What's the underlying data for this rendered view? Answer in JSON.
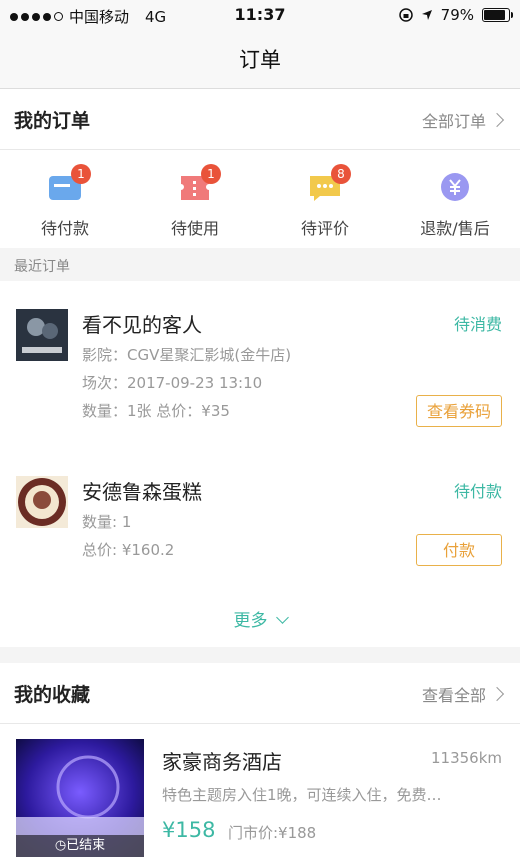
{
  "status_bar": {
    "carrier": "中国移动",
    "network": "4G",
    "time": "11:37",
    "battery": "79%"
  },
  "nav": {
    "title": "订单"
  },
  "my_orders": {
    "title": "我的订单",
    "all_link": "全部订单",
    "quick": [
      {
        "label": "待付款",
        "badge": "1",
        "icon": "card-icon",
        "color": "#5b9ee9"
      },
      {
        "label": "待使用",
        "badge": "1",
        "icon": "ticket-icon",
        "color": "#ef6f6f"
      },
      {
        "label": "待评价",
        "badge": "8",
        "icon": "comment-icon",
        "color": "#f1c232"
      },
      {
        "label": "退款/售后",
        "badge": "",
        "icon": "yen-icon",
        "color": "#8f8ef0"
      }
    ]
  },
  "recent": {
    "label": "最近订单",
    "orders": [
      {
        "name": "看不见的客人",
        "status": "待消费",
        "cinema": "影院：CGV星聚汇影城(金牛店)",
        "session": "场次：2017-09-23 13:10",
        "qty_price": "数量：1张 总价：¥35",
        "button": "查看券码"
      },
      {
        "name": "安德鲁森蛋糕",
        "status": "待付款",
        "qty": "数量: 1",
        "total": "总价: ¥160.2",
        "button": "付款"
      }
    ],
    "more": "更多"
  },
  "favorites": {
    "title": "我的收藏",
    "all_link": "查看全部",
    "item": {
      "name": "家豪商务酒店",
      "distance": "11356km",
      "desc": "特色主题房入住1晚，可连续入住，免费…",
      "price": "¥158",
      "original_price": "门市价:¥188",
      "ended": "已结束"
    }
  },
  "colors": {
    "accent": "#3db8a4",
    "button": "#e9a13a",
    "badge": "#e9533a"
  }
}
